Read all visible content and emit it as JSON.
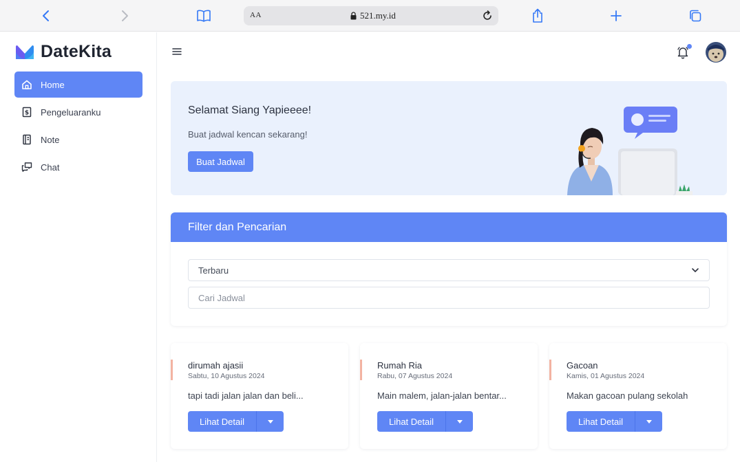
{
  "browser": {
    "url_aa": "AA",
    "url": "521.my.id",
    "icons": [
      "back-icon",
      "forward-icon",
      "book-icon",
      "lock-icon",
      "reload-icon",
      "share-icon",
      "plus-icon",
      "tabs-icon"
    ]
  },
  "sidebar": {
    "brand": "DateKita",
    "items": [
      {
        "label": "Home",
        "icon": "home-icon",
        "active": true
      },
      {
        "label": "Pengeluaranku",
        "icon": "receipt-icon",
        "active": false
      },
      {
        "label": "Note",
        "icon": "notebook-icon",
        "active": false
      },
      {
        "label": "Chat",
        "icon": "chat-icon",
        "active": false
      }
    ]
  },
  "hero": {
    "title": "Selamat Siang Yapieeee!",
    "subtitle": "Buat jadwal kencan sekarang!",
    "button": "Buat Jadwal"
  },
  "filter": {
    "title": "Filter dan Pencarian",
    "sort_selected": "Terbaru",
    "search_placeholder": "Cari Jadwal"
  },
  "cards": [
    {
      "title": "dirumah ajasii",
      "date": "Sabtu, 10 Agustus 2024",
      "desc": "tapi tadi jalan jalan dan beli...",
      "button": "Lihat Detail"
    },
    {
      "title": "Rumah Ria",
      "date": "Rabu, 07 Agustus 2024",
      "desc": "Main malem, jalan-jalan bentar...",
      "button": "Lihat Detail"
    },
    {
      "title": "Gacoan",
      "date": "Kamis, 01 Agustus 2024",
      "desc": "Makan gacoan pulang sekolah",
      "button": "Lihat Detail"
    }
  ],
  "colors": {
    "accent": "#5f86f5",
    "hero_bg": "#eaf1fd",
    "card_accent": "#f3b3a2"
  }
}
